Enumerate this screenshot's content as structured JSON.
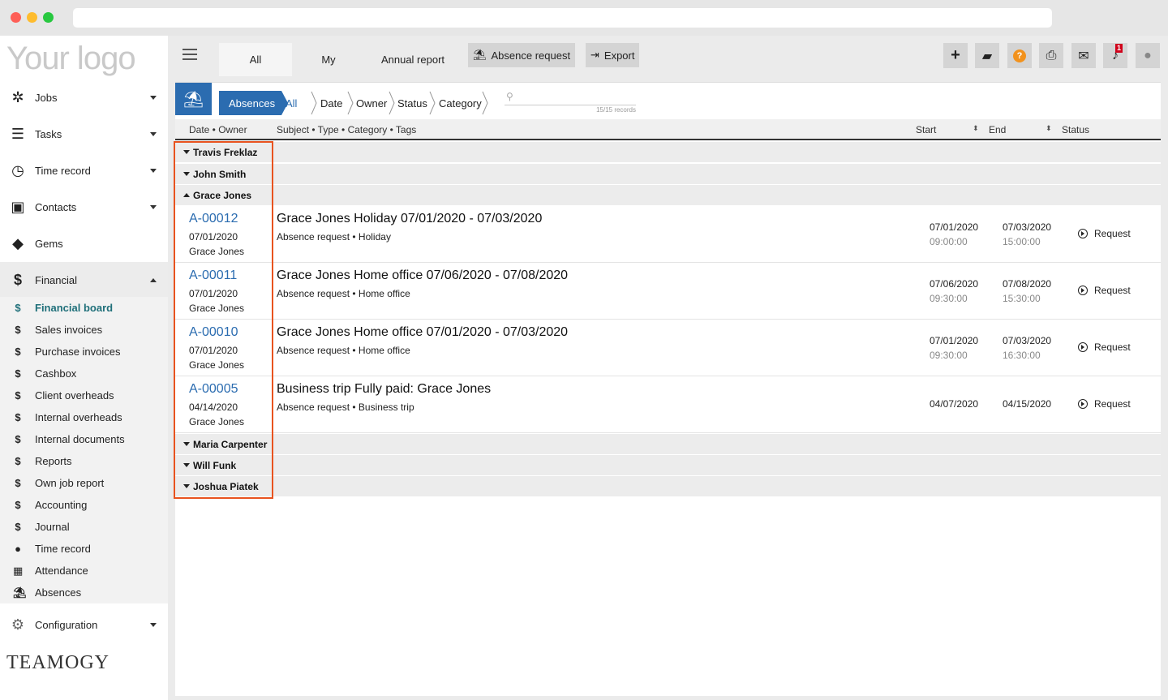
{
  "brand": {
    "logo_text": "Your logo",
    "footer_brand": "TEAMOGY"
  },
  "sidebar": {
    "items": [
      {
        "label": "Jobs",
        "icon": "gear-icon",
        "caret": "down"
      },
      {
        "label": "Tasks",
        "icon": "tasks-icon",
        "caret": "down"
      },
      {
        "label": "Time record",
        "icon": "clock-icon",
        "caret": "down"
      },
      {
        "label": "Contacts",
        "icon": "contacts-icon",
        "caret": "down"
      },
      {
        "label": "Gems",
        "icon": "gem-icon",
        "caret": ""
      },
      {
        "label": "Financial",
        "icon": "dollar-icon",
        "caret": "up"
      }
    ],
    "financial_sub": [
      {
        "label": "Financial board",
        "icon": "$"
      },
      {
        "label": "Sales invoices",
        "icon": "$"
      },
      {
        "label": "Purchase invoices",
        "icon": "$"
      },
      {
        "label": "Cashbox",
        "icon": "$"
      },
      {
        "label": "Client overheads",
        "icon": "$"
      },
      {
        "label": "Internal overheads",
        "icon": "$"
      },
      {
        "label": "Internal documents",
        "icon": "$"
      },
      {
        "label": "Reports",
        "icon": "$"
      },
      {
        "label": "Own job report",
        "icon": "$"
      },
      {
        "label": "Accounting",
        "icon": "$"
      },
      {
        "label": "Journal",
        "icon": "$"
      },
      {
        "label": "Time record",
        "icon": "●"
      },
      {
        "label": "Attendance",
        "icon": "▦"
      },
      {
        "label": "Absences",
        "icon": "⛱"
      }
    ],
    "configuration": "Configuration"
  },
  "toolbar": {
    "tabs": [
      "All",
      "My",
      "Annual report"
    ],
    "absence_request": "Absence request",
    "export": "Export",
    "notification_count": "1"
  },
  "filter": {
    "crumbs": [
      "Absences",
      "All",
      "Date",
      "Owner",
      "Status",
      "Category"
    ],
    "records": "15/15 records"
  },
  "columns": {
    "date_owner": "Date • Owner",
    "subject": "Subject • Type • Category • Tags",
    "start": "Start",
    "end": "End",
    "status": "Status"
  },
  "groups": [
    {
      "name": "Travis Freklaz",
      "expanded": false
    },
    {
      "name": "John Smith",
      "expanded": false
    },
    {
      "name": "Grace Jones",
      "expanded": true
    },
    {
      "name": "Maria Carpenter",
      "expanded": false
    },
    {
      "name": "Will Funk",
      "expanded": false
    },
    {
      "name": "Joshua Piatek",
      "expanded": false
    }
  ],
  "rows": [
    {
      "code": "A-00012",
      "date": "07/01/2020",
      "owner": "Grace Jones",
      "subject": "Grace Jones Holiday 07/01/2020 - 07/03/2020",
      "meta": "Absence request • Holiday",
      "start_date": "07/01/2020",
      "start_time": "09:00:00",
      "end_date": "07/03/2020",
      "end_time": "15:00:00",
      "status": "Request"
    },
    {
      "code": "A-00011",
      "date": "07/01/2020",
      "owner": "Grace Jones",
      "subject": "Grace Jones Home office 07/06/2020 - 07/08/2020",
      "meta": "Absence request • Home office",
      "start_date": "07/06/2020",
      "start_time": "09:30:00",
      "end_date": "07/08/2020",
      "end_time": "15:30:00",
      "status": "Request"
    },
    {
      "code": "A-00010",
      "date": "07/01/2020",
      "owner": "Grace Jones",
      "subject": "Grace Jones Home office 07/01/2020 - 07/03/2020",
      "meta": "Absence request • Home office",
      "start_date": "07/01/2020",
      "start_time": "09:30:00",
      "end_date": "07/03/2020",
      "end_time": "16:30:00",
      "status": "Request"
    },
    {
      "code": "A-00005",
      "date": "04/14/2020",
      "owner": "Grace Jones",
      "subject": "Business trip Fully paid: Grace Jones",
      "meta": "Absence request • Business trip",
      "start_date": "04/07/2020",
      "start_time": "",
      "end_date": "04/15/2020",
      "end_time": "",
      "status": "Request"
    }
  ],
  "colors": {
    "accent": "#2b6cb0",
    "active_nav": "#20707a",
    "highlight": "#e8531f",
    "help": "#f2921d",
    "badge": "#d0021b"
  }
}
